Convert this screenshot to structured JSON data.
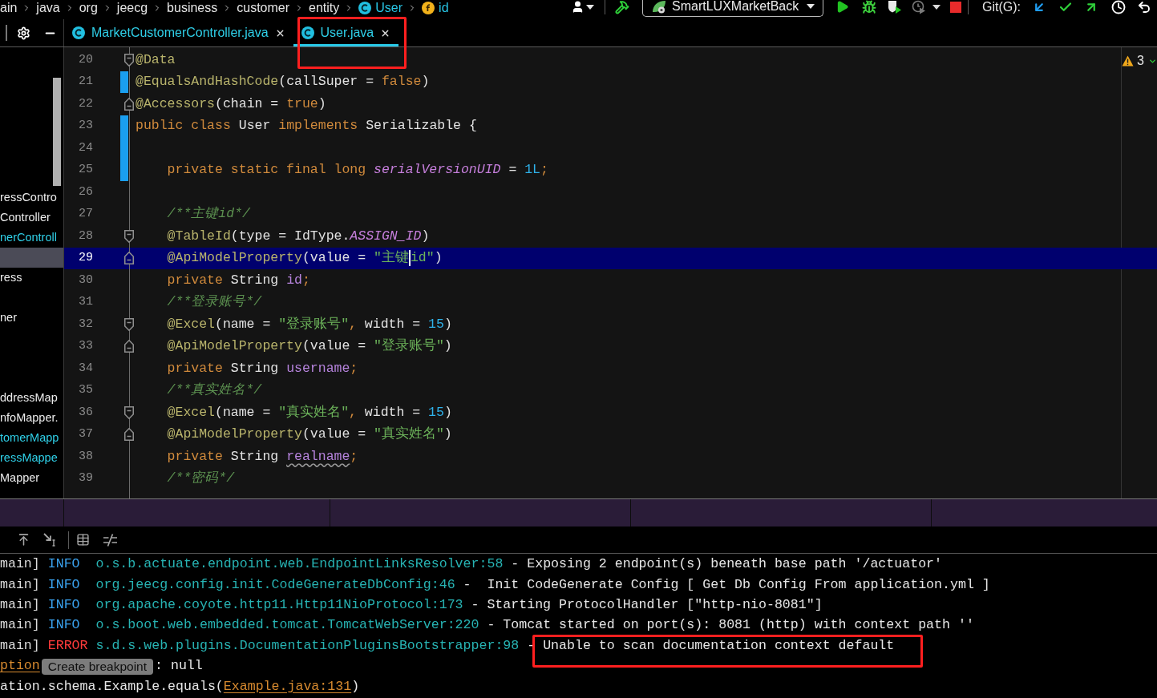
{
  "breadcrumb": [
    {
      "kind": "folder",
      "label": "ain"
    },
    {
      "kind": "folder",
      "label": "java"
    },
    {
      "kind": "folder",
      "label": "org"
    },
    {
      "kind": "folder",
      "label": "jeecg"
    },
    {
      "kind": "folder",
      "label": "business"
    },
    {
      "kind": "folder",
      "label": "customer"
    },
    {
      "kind": "folder",
      "label": "entity"
    },
    {
      "kind": "class",
      "label": "User"
    },
    {
      "kind": "field",
      "label": "id"
    }
  ],
  "toolbar": {
    "run_config": "SmartLUXMarketBack",
    "git_label": "Git(G):"
  },
  "project_tree": {
    "rows": [
      {
        "label": "ressContro",
        "changed": false,
        "selected": false
      },
      {
        "label": "Controller",
        "changed": false,
        "selected": false
      },
      {
        "label": "nerControll",
        "changed": true,
        "selected": false
      },
      {
        "selected": true
      },
      {
        "label": "ress",
        "changed": false,
        "selected": false
      },
      {
        "selected": false
      },
      {
        "label": "ner",
        "changed": false,
        "selected": false
      },
      {
        "selected": false
      },
      {
        "selected": false
      },
      {
        "selected": false
      },
      {
        "label": "ddressMap",
        "changed": false,
        "selected": false
      },
      {
        "label": "nfoMapper.",
        "changed": false,
        "selected": false
      },
      {
        "label": "tomerMapp",
        "changed": true,
        "selected": false
      },
      {
        "label": "ressMappe",
        "changed": true,
        "selected": false
      },
      {
        "label": "Mapper",
        "changed": false,
        "selected": false
      }
    ]
  },
  "editor": {
    "tabs": [
      {
        "label": "MarketCustomerController.java",
        "changed": true,
        "selected": false,
        "highlighted": false
      },
      {
        "label": "User.java",
        "changed": true,
        "selected": true,
        "highlighted": true
      }
    ],
    "warning_count": "3",
    "lines": [
      {
        "number": "20",
        "fold_start": true,
        "fold_end": false,
        "changed": false,
        "current": false,
        "indent": false,
        "tokens": [
          {
            "kind": "annotation",
            "text": "@Data"
          }
        ]
      },
      {
        "number": "21",
        "fold_start": false,
        "fold_end": false,
        "changed": true,
        "current": false,
        "indent": false,
        "tokens": [
          {
            "kind": "annotation",
            "text": "@EqualsAndHashCode"
          },
          {
            "kind": "plain",
            "text": "(callSuper = "
          },
          {
            "kind": "keyword",
            "text": "false"
          },
          {
            "kind": "plain",
            "text": ")"
          }
        ]
      },
      {
        "number": "22",
        "fold_start": false,
        "fold_end": true,
        "changed": false,
        "current": false,
        "indent": false,
        "tokens": [
          {
            "kind": "annotation",
            "text": "@Accessors"
          },
          {
            "kind": "plain",
            "text": "(chain = "
          },
          {
            "kind": "keyword",
            "text": "true"
          },
          {
            "kind": "plain",
            "text": ")"
          }
        ]
      },
      {
        "number": "23",
        "fold_start": false,
        "fold_end": false,
        "changed": true,
        "current": false,
        "indent": false,
        "tokens": [
          {
            "kind": "keyword",
            "text": "public class"
          },
          {
            "kind": "plain",
            "text": " User "
          },
          {
            "kind": "keyword",
            "text": "implements"
          },
          {
            "kind": "plain",
            "text": " Serializable {"
          }
        ]
      },
      {
        "number": "24",
        "fold_start": false,
        "fold_end": false,
        "changed": true,
        "current": false
      },
      {
        "number": "25",
        "fold_start": false,
        "fold_end": false,
        "changed": true,
        "current": false,
        "indent": true,
        "tokens": [
          {
            "kind": "keyword",
            "text": "private static final long "
          },
          {
            "kind": "static",
            "text": "serialVersionUID"
          },
          {
            "kind": "plain",
            "text": " = "
          },
          {
            "kind": "number",
            "text": "1L"
          },
          {
            "kind": "keyword",
            "text": ";"
          }
        ]
      },
      {
        "number": "26",
        "fold_start": false,
        "fold_end": false,
        "changed": false,
        "current": false
      },
      {
        "number": "27",
        "fold_start": false,
        "fold_end": false,
        "changed": false,
        "current": false,
        "indent": true,
        "tokens": [
          {
            "kind": "comment",
            "text": "/**主键id*/"
          }
        ]
      },
      {
        "number": "28",
        "fold_start": true,
        "fold_end": false,
        "changed": false,
        "current": false,
        "indent": true,
        "tokens": [
          {
            "kind": "annotation",
            "text": "@TableId"
          },
          {
            "kind": "plain",
            "text": "(type = IdType."
          },
          {
            "kind": "static",
            "text": "ASSIGN_ID"
          },
          {
            "kind": "plain",
            "text": ")"
          }
        ]
      },
      {
        "number": "29",
        "fold_start": false,
        "fold_end": true,
        "changed": false,
        "current": true,
        "indent": true,
        "tokens": [
          {
            "kind": "annotation",
            "text": "@ApiModelProperty"
          },
          {
            "kind": "plain",
            "text": "(value = "
          },
          {
            "kind": "string",
            "text": "\"主键"
          },
          {
            "kind": "caret"
          },
          {
            "kind": "string",
            "text": "id\""
          },
          {
            "kind": "plain",
            "text": ")"
          }
        ]
      },
      {
        "number": "30",
        "fold_start": false,
        "fold_end": false,
        "changed": false,
        "current": false,
        "indent": true,
        "tokens": [
          {
            "kind": "keyword",
            "text": "private"
          },
          {
            "kind": "plain",
            "text": " String "
          },
          {
            "kind": "field",
            "text": "id"
          },
          {
            "kind": "keyword",
            "text": ";"
          }
        ]
      },
      {
        "number": "31",
        "fold_start": false,
        "fold_end": false,
        "changed": false,
        "current": false,
        "indent": true,
        "tokens": [
          {
            "kind": "comment",
            "text": "/**登录账号*/"
          }
        ]
      },
      {
        "number": "32",
        "fold_start": true,
        "fold_end": false,
        "changed": false,
        "current": false,
        "indent": true,
        "tokens": [
          {
            "kind": "annotation",
            "text": "@Excel"
          },
          {
            "kind": "plain",
            "text": "(name = "
          },
          {
            "kind": "string",
            "text": "\"登录账号\""
          },
          {
            "kind": "keyword",
            "text": ","
          },
          {
            "kind": "plain",
            "text": " width = "
          },
          {
            "kind": "number",
            "text": "15"
          },
          {
            "kind": "plain",
            "text": ")"
          }
        ]
      },
      {
        "number": "33",
        "fold_start": false,
        "fold_end": true,
        "changed": false,
        "current": false,
        "indent": true,
        "tokens": [
          {
            "kind": "annotation",
            "text": "@ApiModelProperty"
          },
          {
            "kind": "plain",
            "text": "(value = "
          },
          {
            "kind": "string",
            "text": "\"登录账号\""
          },
          {
            "kind": "plain",
            "text": ")"
          }
        ]
      },
      {
        "number": "34",
        "fold_start": false,
        "fold_end": false,
        "changed": false,
        "current": false,
        "indent": true,
        "tokens": [
          {
            "kind": "keyword",
            "text": "private"
          },
          {
            "kind": "plain",
            "text": " String "
          },
          {
            "kind": "field",
            "text": "username"
          },
          {
            "kind": "keyword",
            "text": ";"
          }
        ]
      },
      {
        "number": "35",
        "fold_start": false,
        "fold_end": false,
        "changed": false,
        "current": false,
        "indent": true,
        "tokens": [
          {
            "kind": "comment",
            "text": "/**真实姓名*/"
          }
        ]
      },
      {
        "number": "36",
        "fold_start": true,
        "fold_end": false,
        "changed": false,
        "current": false,
        "indent": true,
        "tokens": [
          {
            "kind": "annotation",
            "text": "@Excel"
          },
          {
            "kind": "plain",
            "text": "(name = "
          },
          {
            "kind": "string",
            "text": "\"真实姓名\""
          },
          {
            "kind": "keyword",
            "text": ","
          },
          {
            "kind": "plain",
            "text": " width = "
          },
          {
            "kind": "number",
            "text": "15"
          },
          {
            "kind": "plain",
            "text": ")"
          }
        ]
      },
      {
        "number": "37",
        "fold_start": false,
        "fold_end": true,
        "changed": false,
        "current": false,
        "indent": true,
        "tokens": [
          {
            "kind": "annotation",
            "text": "@ApiModelProperty"
          },
          {
            "kind": "plain",
            "text": "(value = "
          },
          {
            "kind": "string",
            "text": "\"真实姓名\""
          },
          {
            "kind": "plain",
            "text": ")"
          }
        ]
      },
      {
        "number": "38",
        "fold_start": false,
        "fold_end": false,
        "changed": false,
        "current": false,
        "indent": true,
        "tokens": [
          {
            "kind": "keyword",
            "text": "private"
          },
          {
            "kind": "plain",
            "text": " String "
          },
          {
            "kind": "field_typo",
            "text": "realname"
          },
          {
            "kind": "keyword",
            "text": ";"
          }
        ]
      },
      {
        "number": "39",
        "fold_start": false,
        "fold_end": false,
        "changed": false,
        "current": false,
        "indent": true,
        "tokens": [
          {
            "kind": "comment",
            "text": "/**密码*/"
          }
        ]
      }
    ]
  },
  "console": {
    "lines": [
      {
        "segments": [
          {
            "kind": "thread",
            "text": "main]"
          },
          {
            "kind": "info",
            "text": "INFO"
          },
          {
            "kind": "logger",
            "text": "o.s.b.actuate.endpoint.web.EndpointLinksResolver:58"
          },
          {
            "kind": "message",
            "text": "- Exposing 2 endpoint(s) beneath base path '/actuator'",
            "highlighted": false
          }
        ]
      },
      {
        "segments": [
          {
            "kind": "thread",
            "text": "main]"
          },
          {
            "kind": "info",
            "text": "INFO"
          },
          {
            "kind": "logger",
            "text": "org.jeecg.config.init.CodeGenerateDbConfig:46"
          },
          {
            "kind": "message",
            "text": "-  Init CodeGenerate Config [ Get Db Config From application.yml ]",
            "highlighted": false
          }
        ]
      },
      {
        "segments": [
          {
            "kind": "thread",
            "text": "main]"
          },
          {
            "kind": "info",
            "text": "INFO"
          },
          {
            "kind": "logger",
            "text": "org.apache.coyote.http11.Http11NioProtocol:173"
          },
          {
            "kind": "message",
            "text": "- Starting ProtocolHandler [\"http-nio-8081\"]",
            "highlighted": false
          }
        ]
      },
      {
        "segments": [
          {
            "kind": "thread",
            "text": "main]"
          },
          {
            "kind": "info",
            "text": "INFO"
          },
          {
            "kind": "logger",
            "text": "o.s.boot.web.embedded.tomcat.TomcatWebServer:220"
          },
          {
            "kind": "message",
            "text": "- Tomcat started on port(s): 8081 (http) with context path ''",
            "highlighted": false
          }
        ]
      },
      {
        "segments": [
          {
            "kind": "thread",
            "text": "main]"
          },
          {
            "kind": "error",
            "text": "ERROR"
          },
          {
            "kind": "logger",
            "text": "s.d.s.web.plugins.DocumentationPluginsBootstrapper:98"
          },
          {
            "kind": "message",
            "text": "-",
            "highlighted": false
          },
          {
            "kind": "message",
            "text": "Unable to scan documentation context default",
            "highlighted": true
          }
        ]
      },
      {
        "segments": [
          {
            "kind": "link",
            "text": "ption"
          },
          {
            "kind": "button",
            "text": "Create breakpoint"
          },
          {
            "kind": "text",
            "text": ": null"
          }
        ]
      },
      {
        "segments": [
          {
            "kind": "text",
            "text": "ation.schema.Example.equals("
          },
          {
            "kind": "link",
            "text": "Example.java:131"
          },
          {
            "kind": "text",
            "text": ")"
          }
        ]
      }
    ]
  }
}
